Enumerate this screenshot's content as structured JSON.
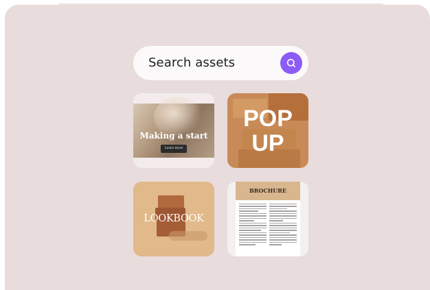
{
  "search": {
    "placeholder": "Search assets",
    "button_icon": "search-icon",
    "button_color": "#8b5cf6"
  },
  "cards": [
    {
      "title": "Making a start",
      "button_label": "Learn more"
    },
    {
      "title_line1": "POP",
      "title_line2": "UP"
    },
    {
      "title": "LOOKBOOK"
    },
    {
      "title": "BROCHURE"
    }
  ],
  "colors": {
    "background": "#e8dcdc",
    "accent": "#8b5cf6"
  }
}
